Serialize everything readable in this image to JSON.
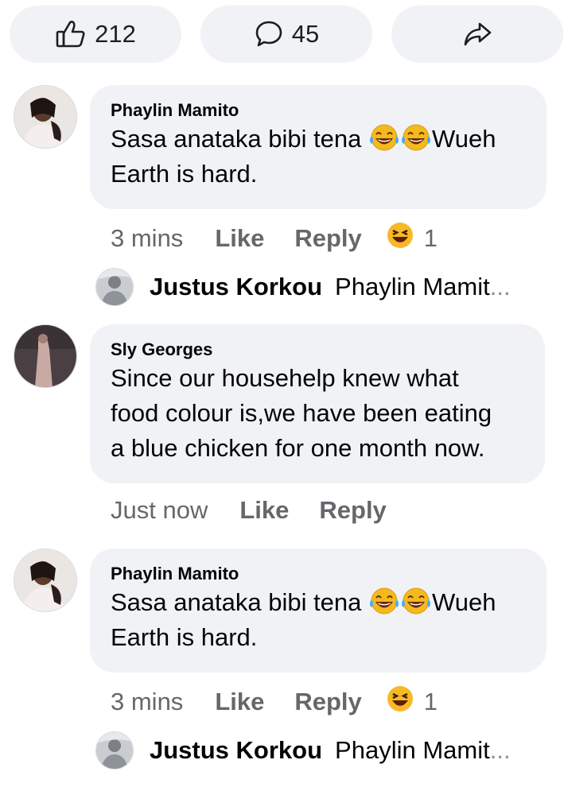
{
  "actions": {
    "like_count": "212",
    "comment_count": "45"
  },
  "comments": [
    {
      "author": "Phaylin Mamito",
      "text_line1": "Sasa anataka bibi tena",
      "text_after_emoji": "Wueh",
      "text_line2": "Earth is hard.",
      "time": "3 mins",
      "like_label": "Like",
      "reply_label": "Reply",
      "reaction_count": "1",
      "reply": {
        "name": "Justus Korkou",
        "preview": "Phaylin Mamit",
        "ellipsis": "..."
      }
    },
    {
      "author": "Sly Georges",
      "text_lines": [
        "Since our househelp knew what",
        "food colour is,we have been eating",
        "a blue chicken for one month now."
      ],
      "time": "Just now",
      "like_label": "Like",
      "reply_label": "Reply"
    },
    {
      "author": "Phaylin Mamito",
      "text_line1": "Sasa anataka bibi tena",
      "text_after_emoji": "Wueh",
      "text_line2": "Earth is hard.",
      "time": "3 mins",
      "like_label": "Like",
      "reply_label": "Reply",
      "reaction_count": "1",
      "reply": {
        "name": "Justus Korkou",
        "preview": "Phaylin Mamit",
        "ellipsis": "..."
      }
    }
  ],
  "icons": {
    "like": "thumbs-up-icon",
    "comment": "comment-icon",
    "share": "share-icon",
    "emoji_laugh": "tears-of-joy-emoji",
    "reaction_haha": "haha-reaction-icon"
  },
  "colors": {
    "bubble_bg": "#f0f2f5",
    "meta_text": "#65676b",
    "text": "#050505"
  }
}
